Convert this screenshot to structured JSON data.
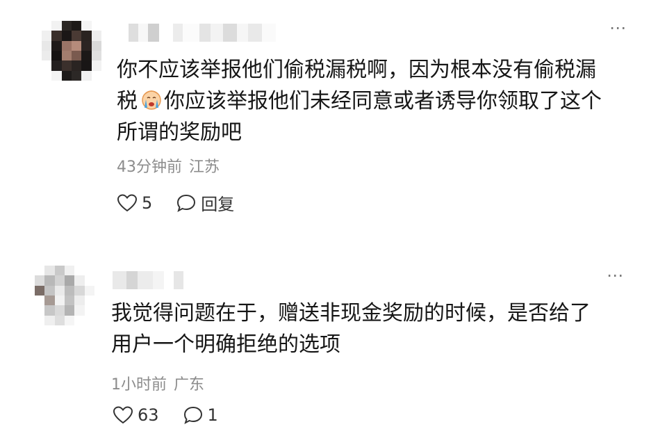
{
  "comments": [
    {
      "text_line1": "你不应该举报他们偷税漏税啊，因为根本没有偷税漏",
      "text_line2_pre": "税",
      "emoji": "crying-face-emoji",
      "text_line2_post": "你应该举报他们未经同意或者诱导你领取了这个",
      "text_line3": "所谓的奖励吧",
      "time": "43分钟前",
      "location": "江苏",
      "likes": "5",
      "reply_label": "回复"
    },
    {
      "text": "我觉得问题在于，赠送非现金奖励的时候，是否给了\n用户一个明确拒绝的选项",
      "time": "1小时前",
      "location": "广东",
      "likes": "63",
      "reply_count": "1"
    }
  ],
  "more_icon": "⋯",
  "colors": {
    "text": "#161616",
    "meta": "#8c8c8c",
    "icon": "#333333"
  }
}
